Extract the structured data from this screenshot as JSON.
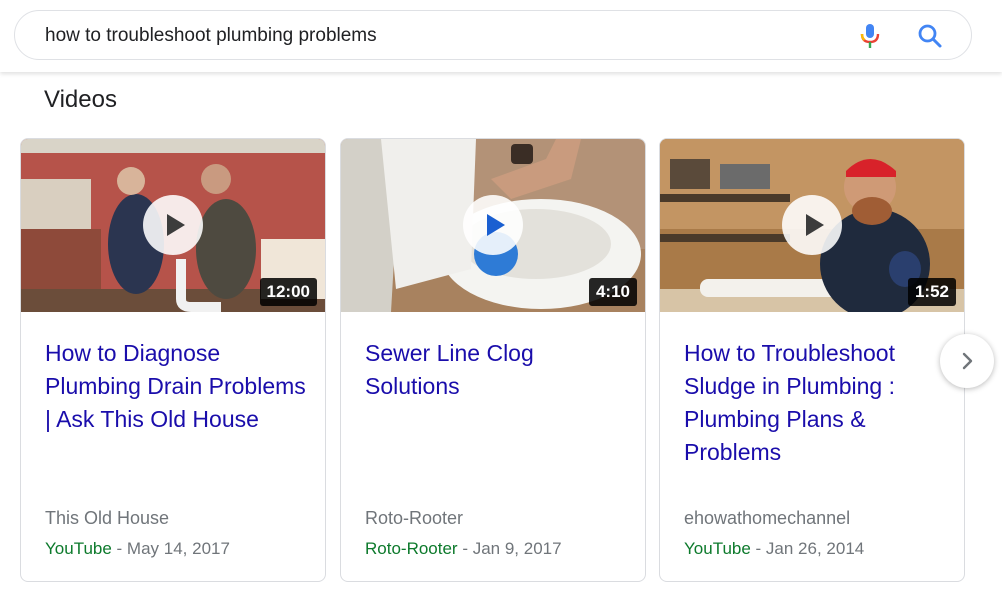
{
  "search": {
    "query": "how to troubleshoot plumbing problems"
  },
  "section": {
    "title": "Videos"
  },
  "videos": [
    {
      "title": "How to Diagnose Plumbing Drain Problems | Ask This Old House",
      "duration": "12:00",
      "channel": "This Old House",
      "site": "YouTube",
      "date": " - May 14, 2017"
    },
    {
      "title": "Sewer Line Clog Solutions",
      "duration": "4:10",
      "channel": "Roto-Rooter",
      "site": "Roto-Rooter",
      "date": " - Jan 9, 2017"
    },
    {
      "title": "How to Troubleshoot Sludge in Plumbing : Plumbing Plans & Problems",
      "duration": "1:52",
      "channel": "ehowathomechannel",
      "site": "YouTube",
      "date": " - Jan 26, 2014"
    }
  ],
  "colors": {
    "link": "#1a0dab",
    "site": "#0d7a2c",
    "meta": "#70757a",
    "accent_blue": "#4285f4"
  },
  "icons": {
    "mic": "microphone-icon",
    "search": "search-icon",
    "next": "chevron-right-icon",
    "play": "play-icon"
  }
}
